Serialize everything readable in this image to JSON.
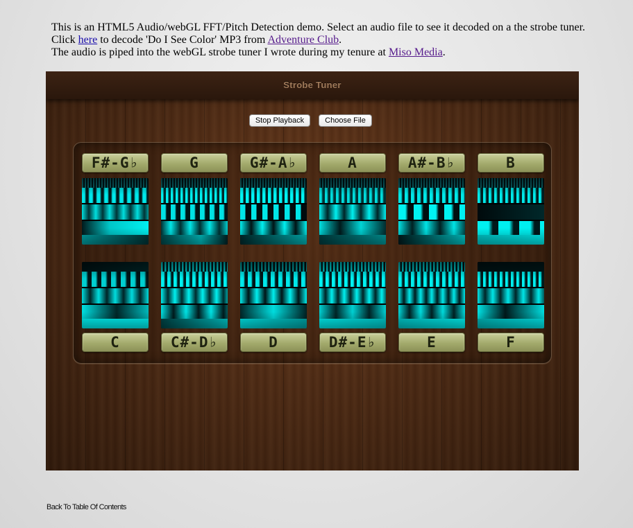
{
  "intro": {
    "line1": "This is an HTML5 Audio/webGL FFT/Pitch Detection demo. Select an audio file to see it decoded on a the strobe tuner.",
    "line2_pre": "Click ",
    "line2_link": "here",
    "line2_mid": " to decode 'Do I See Color' MP3 from ",
    "line2_link2": "Adventure Club",
    "line2_post": ".",
    "line3_pre": "The audio is piped into the webGL strobe tuner I wrote during my tenure at ",
    "line3_link": "Miso Media",
    "line3_post": "."
  },
  "tuner": {
    "title": "Strobe Tuner",
    "stop_label": "Stop Playback",
    "choose_label": "Choose File",
    "strobe_color": "#00f0f0",
    "lcd_color": "#b8be82",
    "top_notes": [
      "F#-G♭",
      "G",
      "G#-A♭",
      "A",
      "A#-B♭",
      "B"
    ],
    "bottom_notes": [
      "C",
      "C#-D♭",
      "D",
      "D#-E♭",
      "E",
      "F"
    ]
  },
  "footer": {
    "back_label": "Back To Table Of Contents"
  }
}
